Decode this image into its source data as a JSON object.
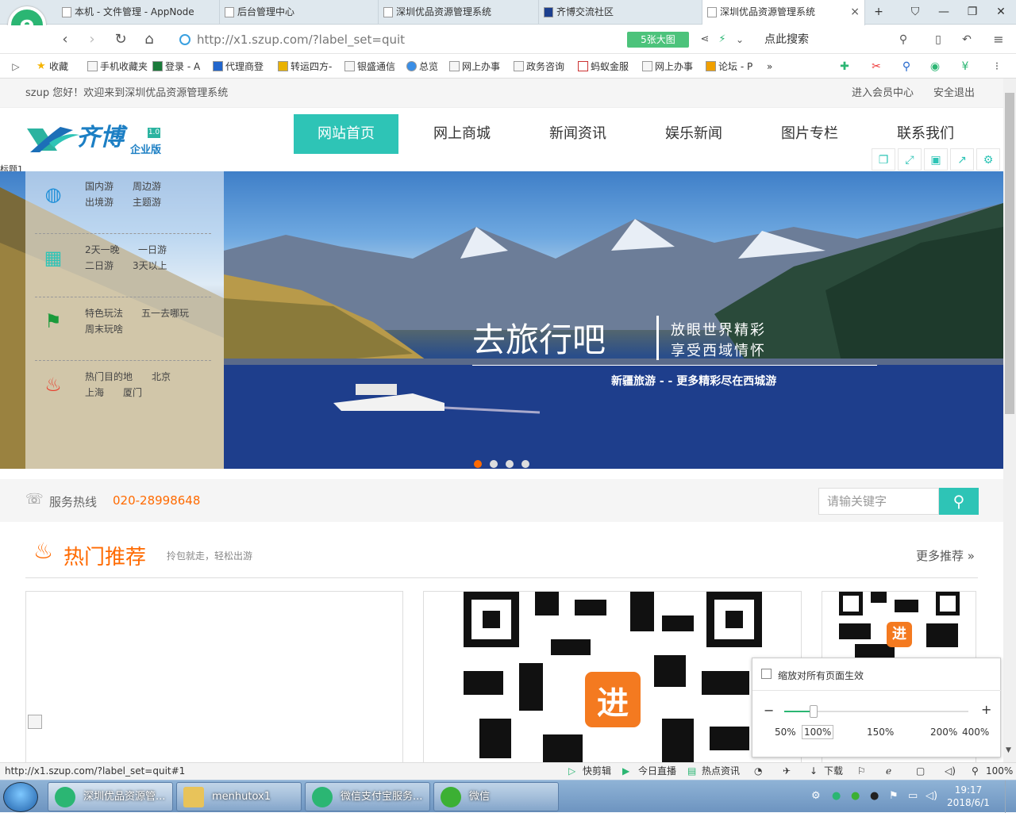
{
  "browser": {
    "tabs": [
      {
        "title": "本机 - 文件管理 - AppNode",
        "active": false
      },
      {
        "title": "后台管理中心",
        "active": false
      },
      {
        "title": "深圳优品资源管理系统",
        "active": false
      },
      {
        "title": "齐博交流社区",
        "active": false
      },
      {
        "title": "深圳优品资源管理系统",
        "active": true
      }
    ],
    "new_tab": "+",
    "url": "http://x1.szup.com/?label_set=quit",
    "url_domain": "x1.szup.com",
    "big_image_badge": "5张大图",
    "search_placeholder": "点此搜索",
    "bookmarks": [
      "收藏",
      "手机收藏夹",
      "登录 - A",
      "代理商登",
      "转运四方-",
      "银盛通信",
      "总览",
      "网上办事",
      "政务咨询",
      "蚂蚁金服",
      "网上办事",
      "论坛 - P"
    ],
    "bookmark_more": "»"
  },
  "site": {
    "welcome": "szup 您好！欢迎来到深圳优品资源管理系统",
    "member_center": "进入会员中心",
    "logout": "安全退出",
    "logo_text": "齐博",
    "logo_version": "1.0",
    "logo_sub": "企业版",
    "nav": [
      "网站首页",
      "网上商城",
      "新闻资讯",
      "娱乐新闻",
      "图片专栏",
      "联系我们"
    ],
    "title_label": "标题1",
    "categories": [
      {
        "icon": "globe-icon",
        "links": [
          "国内游",
          "周边游",
          "出境游",
          "主题游"
        ]
      },
      {
        "icon": "calendar-icon",
        "links": [
          "2天一晚",
          "一日游",
          "二日游",
          "3天以上"
        ]
      },
      {
        "icon": "signpost-icon",
        "links": [
          "特色玩法",
          "五一去哪玩",
          "周末玩啥"
        ]
      },
      {
        "icon": "fire-icon",
        "links": [
          "热门目的地",
          "北京",
          "上海",
          "厦门"
        ]
      }
    ],
    "slogan": {
      "main": "去旅行吧",
      "line1": "放眼世界精彩",
      "line2": "享受西域情怀",
      "sub": "新疆旅游 - - 更多精彩尽在西城游"
    },
    "hotline_label": "服务热线",
    "hotline_number": "020-28998648",
    "search_placeholder": "请输关键字",
    "hot_title": "热门推荐",
    "hot_sub": "拎包就走，轻松出游",
    "more": "更多推荐 »"
  },
  "zoom_popup": {
    "apply_all": "缩放对所有页面生效",
    "levels": [
      "50%",
      "100%",
      "150%",
      "200%",
      "400%"
    ],
    "current": "100%"
  },
  "statusbar": {
    "link": "http://x1.szup.com/?label_set=quit#1",
    "items": [
      "快剪辑",
      "今日直播",
      "热点资讯",
      "下载"
    ],
    "zoom": "100%"
  },
  "taskbar": {
    "tasks": [
      "深圳优品资源管...",
      "menhutox1",
      "微信支付宝服务...",
      "微信"
    ],
    "time": "19:17",
    "date": "2018/6/1"
  }
}
